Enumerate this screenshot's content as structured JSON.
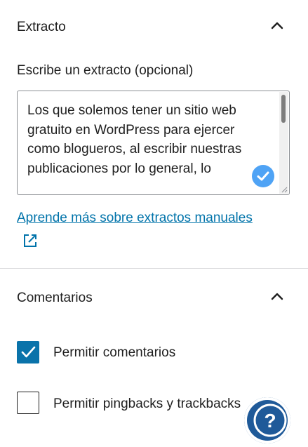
{
  "excerpt_panel": {
    "title": "Extracto",
    "field_label": "Escribe un extracto (opcional)",
    "excerpt_text": "Los que solemos tener un sitio web gratuito en WordPress para ejercer como blogueros, al escribir nuestras publicaciones por lo general, lo",
    "learn_more_link": "Aprende más sobre extractos manuales"
  },
  "comments_panel": {
    "title": "Comentarios",
    "options": [
      {
        "label": "Permitir comentarios",
        "checked": true
      },
      {
        "label": "Permitir pingbacks y trackbacks",
        "checked": false
      }
    ]
  },
  "colors": {
    "accent": "#0a73aa",
    "link": "#0073aa",
    "help_button": "#1f5a99"
  },
  "icons": {
    "collapse": "chevron-up-icon",
    "external": "external-link-icon",
    "check": "checkmark-icon",
    "help": "help-question-icon"
  }
}
